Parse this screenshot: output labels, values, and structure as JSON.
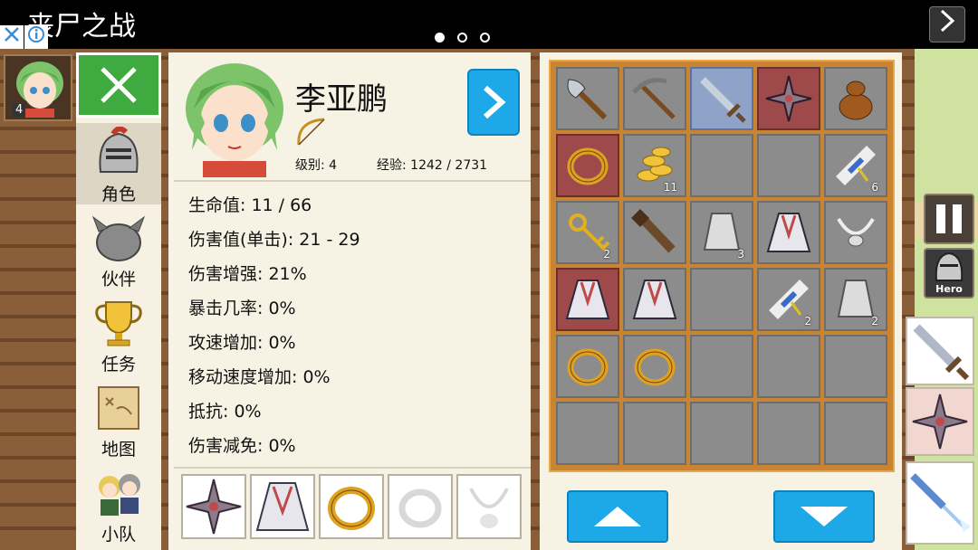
{
  "ad": {
    "title": "丧尸之战",
    "close_icon": "close-icon",
    "info_icon": "info-icon",
    "carousel_dots": 3,
    "active_dot": 0
  },
  "party": {
    "slot_level": "4"
  },
  "sidebar": {
    "items": [
      {
        "label": "角色",
        "icon": "helmet-icon",
        "active": true
      },
      {
        "label": "伙伴",
        "icon": "companion-icon",
        "active": false
      },
      {
        "label": "任务",
        "icon": "trophy-icon",
        "active": false
      },
      {
        "label": "地图",
        "icon": "map-icon",
        "active": false
      },
      {
        "label": "小队",
        "icon": "team-icon",
        "active": false
      }
    ]
  },
  "character": {
    "name": "李亚鹏",
    "level_text": "级别: 4",
    "exp_text": "经验: 1242 / 2731",
    "weapon_icon": "bow-icon",
    "stats": [
      "生命值: 11 / 66",
      "伤害值(单击): 21 - 29",
      "伤害增强: 21%",
      "暴击几率: 0%",
      "攻速增加: 0%",
      "移动速度增加: 0%",
      "抵抗: 0%",
      "伤害减免: 0%"
    ],
    "equipped": [
      {
        "icon": "shuriken-icon",
        "empty": false
      },
      {
        "icon": "cloak-icon",
        "empty": false
      },
      {
        "icon": "ring-icon",
        "empty": false
      },
      {
        "icon": "ring-slot-icon",
        "empty": true
      },
      {
        "icon": "amulet-slot-icon",
        "empty": true
      }
    ]
  },
  "inventory": {
    "rows": [
      [
        {
          "icon": "axe-icon",
          "count": ""
        },
        {
          "icon": "pickaxe-icon",
          "count": ""
        },
        {
          "icon": "sword-icon",
          "count": "",
          "style": "blue"
        },
        {
          "icon": "shuriken-icon",
          "count": "",
          "style": "red"
        },
        {
          "icon": "gourd-icon",
          "count": ""
        }
      ],
      [
        {
          "icon": "ring-icon",
          "count": "",
          "style": "red"
        },
        {
          "icon": "gold-coins-icon",
          "count": "11"
        },
        {
          "icon": "",
          "count": ""
        },
        {
          "icon": "",
          "count": ""
        },
        {
          "icon": "scroll-icon",
          "count": "6"
        }
      ],
      [
        {
          "icon": "key-icon",
          "count": "2"
        },
        {
          "icon": "club-icon",
          "count": ""
        },
        {
          "icon": "stone-icon",
          "count": "3"
        },
        {
          "icon": "cloak-icon",
          "count": ""
        },
        {
          "icon": "necklace-icon",
          "count": ""
        }
      ],
      [
        {
          "icon": "cloak-icon",
          "count": "",
          "style": "red"
        },
        {
          "icon": "cloak-icon",
          "count": ""
        },
        {
          "icon": "",
          "count": ""
        },
        {
          "icon": "scroll-icon",
          "count": "2"
        },
        {
          "icon": "stone-icon",
          "count": "2"
        }
      ],
      [
        {
          "icon": "ring-icon",
          "count": ""
        },
        {
          "icon": "ring-icon",
          "count": ""
        },
        {
          "icon": "",
          "count": ""
        },
        {
          "icon": "",
          "count": ""
        },
        {
          "icon": "",
          "count": ""
        }
      ],
      [
        {
          "icon": "",
          "count": ""
        },
        {
          "icon": "",
          "count": ""
        },
        {
          "icon": "",
          "count": ""
        },
        {
          "icon": "",
          "count": ""
        },
        {
          "icon": "",
          "count": ""
        }
      ]
    ],
    "scroll_up_icon": "arrow-up-icon",
    "scroll_down_icon": "arrow-down-icon"
  },
  "hud": {
    "pause_icon": "pause-icon",
    "hero_label": "Hero",
    "skills": [
      "sword-icon",
      "shuriken-icon",
      "spear-icon"
    ]
  },
  "colors": {
    "accent_blue": "#1da8e8",
    "close_green": "#3faa3f",
    "grid_orange": "#c98432",
    "panel_bg": "#f7f3e4"
  }
}
